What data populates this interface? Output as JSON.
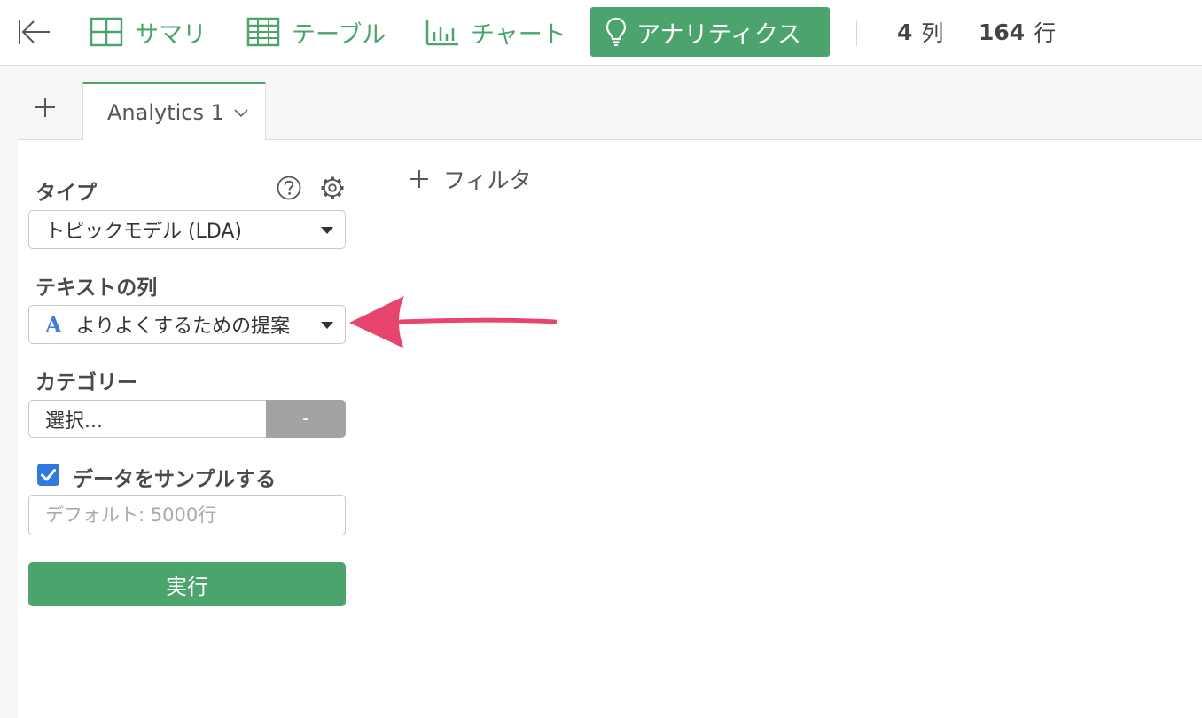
{
  "toolbar": {
    "tabs": [
      {
        "label": "サマリ",
        "icon": "grid-icon"
      },
      {
        "label": "テーブル",
        "icon": "table-icon"
      },
      {
        "label": "チャート",
        "icon": "bar-chart-icon"
      },
      {
        "label": "アナリティクス",
        "icon": "lightbulb-icon",
        "active": true
      }
    ],
    "columns_count": "4",
    "columns_unit": "列",
    "rows_count": "164",
    "rows_unit": "行"
  },
  "tabstrip": {
    "tab_label": "Analytics 1"
  },
  "form": {
    "type_label": "タイプ",
    "type_value": "トピックモデル (LDA)",
    "text_column_label": "テキストの列",
    "text_column_type_glyph": "A",
    "text_column_value": "よりよくするための提案",
    "category_label": "カテゴリー",
    "category_value": "選択...",
    "category_button": "-",
    "sample_label": "データをサンプルする",
    "sample_checked": true,
    "sample_placeholder": "デフォルト: 5000行",
    "run_button": "実行"
  },
  "filter": {
    "label": "フィルタ"
  },
  "colors": {
    "accent": "#4aa46c",
    "checkbox": "#2f79e0",
    "annotation_arrow": "#e8456e",
    "string_type": "#3a7fd0"
  }
}
